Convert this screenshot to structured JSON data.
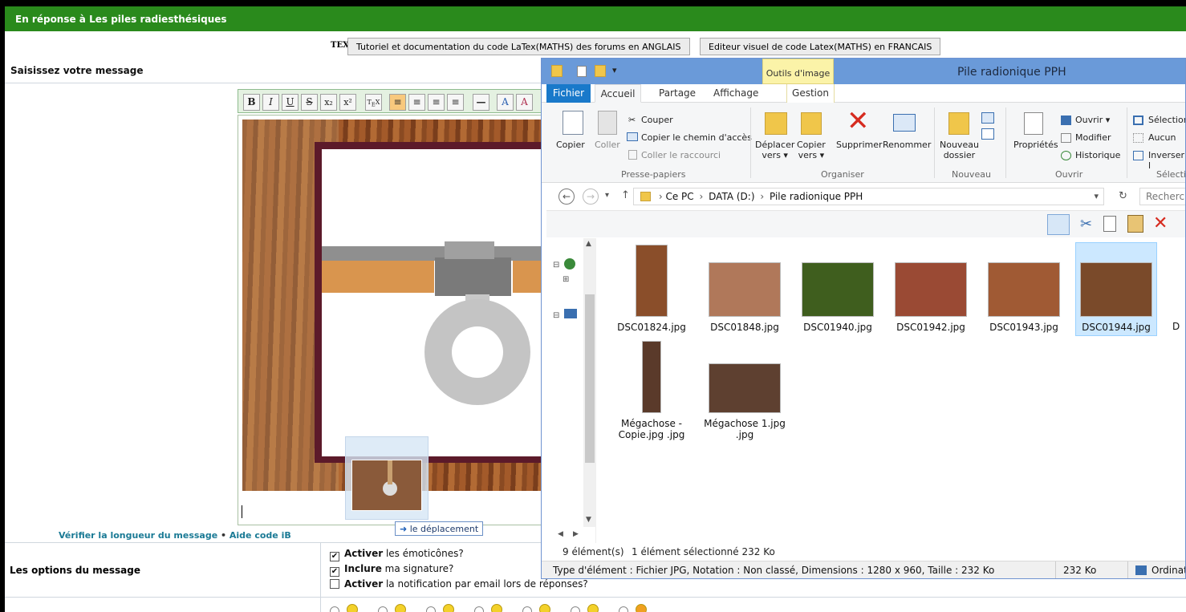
{
  "forum": {
    "header_title": "En réponse à Les piles radiesthésiques",
    "latex_icon": "TEX",
    "latex_btn_en": "Tutoriel et documentation du code LaTex(MATHS) des forums en ANGLAIS",
    "latex_btn_fr": "Editeur visuel de code Latex(MATHS) en FRANCAIS",
    "prompt": "Saisissez votre message",
    "toolbar": [
      "B",
      "I",
      "U",
      "S",
      "x₂",
      "x²"
    ],
    "drag_tooltip": "le déplacement",
    "check_length": "Vérifier la longueur du message",
    "separator": " • ",
    "help_link": "Aide code iB",
    "options_label": "Les options du message",
    "options": [
      {
        "bold": "Activer",
        "rest": " les émoticônes?",
        "checked": true
      },
      {
        "bold": "Inclure",
        "rest": " ma signature?",
        "checked": true
      },
      {
        "bold": "Activer",
        "rest": " la notification par email lors de réponses?",
        "checked": false
      }
    ]
  },
  "explorer": {
    "context_tab": "Outils d'image",
    "title": "Pile radionique PPH",
    "tabs": {
      "fichier": "Fichier",
      "accueil": "Accueil",
      "partage": "Partage",
      "affichage": "Affichage",
      "gestion": "Gestion"
    },
    "ribbon": {
      "copier": "Copier",
      "coller": "Coller",
      "couper": "Couper",
      "copier_chemin": "Copier le chemin d'accès",
      "coller_raccourci": "Coller le raccourci",
      "group_presse": "Presse-papiers",
      "deplacer": "Déplacer",
      "deplacer2": "vers ▾",
      "copier_vers": "Copier",
      "copier_vers2": "vers ▾",
      "supprimer": "Supprimer",
      "renommer": "Renommer",
      "group_organiser": "Organiser",
      "nouveau_dossier": "Nouveau",
      "nouveau_dossier2": "dossier",
      "group_nouveau": "Nouveau",
      "proprietes": "Propriétés",
      "ouvrir": "Ouvrir ▾",
      "modifier": "Modifier",
      "historique": "Historique",
      "group_ouvrir": "Ouvrir",
      "selection": "Sélection",
      "aucun": "Aucun",
      "inverser": "Inverser l",
      "group_selection": "Sélectio"
    },
    "address": {
      "pc": "Ce PC",
      "drive": "DATA (D:)",
      "folder": "Pile radionique PPH",
      "sep": "›"
    },
    "search_placeholder": "Recherch",
    "files": [
      {
        "name": "DSC01824.jpg",
        "color": "#8a4e2a"
      },
      {
        "name": "DSC01848.jpg",
        "color": "#b0785a"
      },
      {
        "name": "DSC01940.jpg",
        "color": "#3f5e1e"
      },
      {
        "name": "DSC01942.jpg",
        "color": "#9a4a34"
      },
      {
        "name": "DSC01943.jpg",
        "color": "#a05a34"
      },
      {
        "name": "DSC01944.jpg",
        "color": "#7a4a2a"
      }
    ],
    "files_row2": [
      {
        "name": "Mégachose -",
        "name2": "Copie.jpg .jpg",
        "color": "#5a3a2a"
      },
      {
        "name": "Mégachose 1.jpg",
        "name2": ".jpg",
        "color": "#5e4030"
      }
    ],
    "partial_file": "D",
    "status_count": "9 élément(s)",
    "status_selected": "1 élément sélectionné  232 Ko",
    "details": "Type d'élément : Fichier JPG, Notation : Non classé, Dimensions : 1280 x 960, Taille : 232 Ko",
    "details_size": "232 Ko",
    "details_computer": "Ordinate"
  }
}
